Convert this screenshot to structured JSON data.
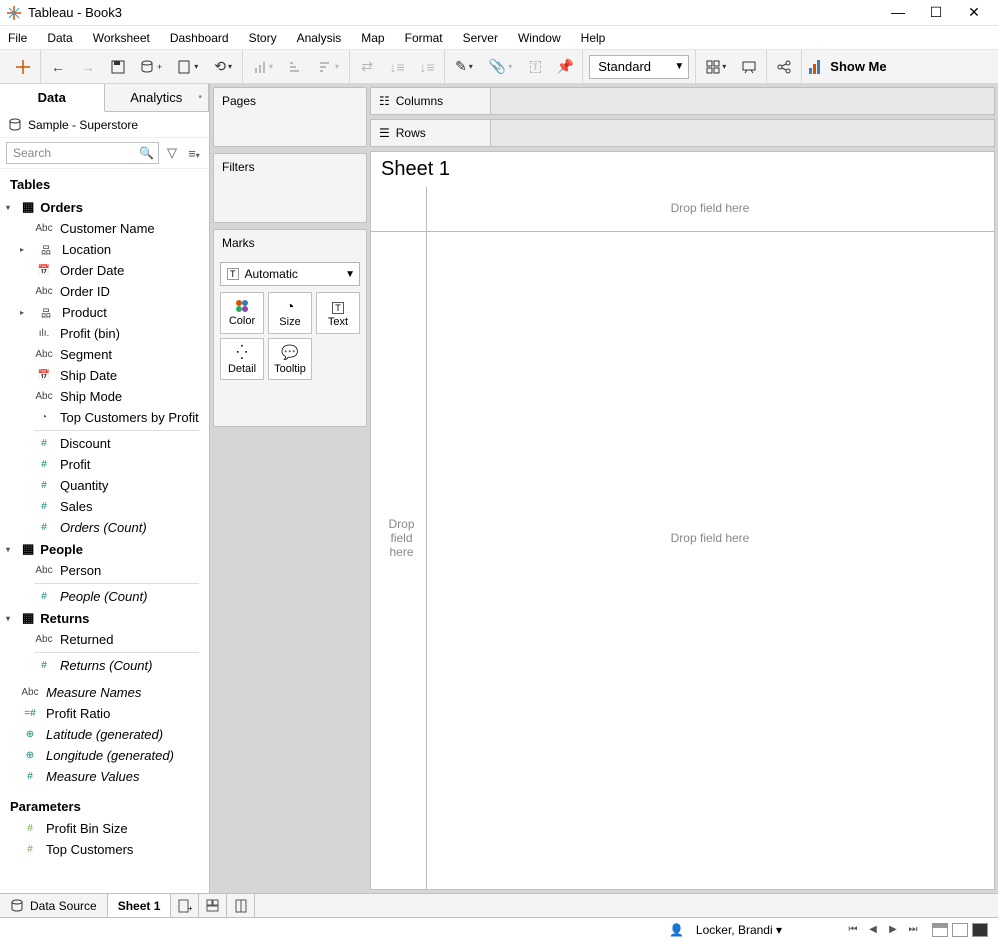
{
  "title": "Tableau - Book3",
  "menu": [
    "File",
    "Data",
    "Worksheet",
    "Dashboard",
    "Story",
    "Analysis",
    "Map",
    "Format",
    "Server",
    "Window",
    "Help"
  ],
  "toolbar": {
    "fit": "Standard",
    "showme": "Show Me"
  },
  "dataTabs": {
    "data": "Data",
    "analytics": "Analytics"
  },
  "dataSource": "Sample - Superstore",
  "search": {
    "placeholder": "Search"
  },
  "tables_h": "Tables",
  "tree": {
    "orders": {
      "name": "Orders",
      "fields": [
        {
          "icon": "Abc",
          "label": "Customer Name",
          "cls": "dim"
        },
        {
          "icon": "⇵",
          "label": "Location",
          "cls": "dim",
          "exp": true
        },
        {
          "icon": "📅",
          "label": "Order Date",
          "cls": "dim"
        },
        {
          "icon": "Abc",
          "label": "Order ID",
          "cls": "dim"
        },
        {
          "icon": "⇵",
          "label": "Product",
          "cls": "dim",
          "exp": true
        },
        {
          "icon": "ılı.",
          "label": "Profit (bin)",
          "cls": "dim"
        },
        {
          "icon": "Abc",
          "label": "Segment",
          "cls": "dim"
        },
        {
          "icon": "📅",
          "label": "Ship Date",
          "cls": "dim"
        },
        {
          "icon": "Abc",
          "label": "Ship Mode",
          "cls": "dim"
        },
        {
          "icon": "◔",
          "label": "Top Customers by Profit",
          "cls": "dim"
        }
      ],
      "sep": true,
      "measures": [
        {
          "icon": "#",
          "label": "Discount"
        },
        {
          "icon": "#",
          "label": "Profit"
        },
        {
          "icon": "#",
          "label": "Quantity"
        },
        {
          "icon": "#",
          "label": "Sales"
        },
        {
          "icon": "#",
          "label": "Orders (Count)",
          "italic": true
        }
      ]
    },
    "people": {
      "name": "People",
      "fields": [
        {
          "icon": "Abc",
          "label": "Person",
          "cls": "dim"
        }
      ],
      "measures": [
        {
          "icon": "#",
          "label": "People (Count)",
          "italic": true
        }
      ]
    },
    "returns": {
      "name": "Returns",
      "fields": [
        {
          "icon": "Abc",
          "label": "Returned",
          "cls": "dim"
        }
      ],
      "measures": [
        {
          "icon": "#",
          "label": "Returns (Count)",
          "italic": true
        }
      ]
    },
    "loose": [
      {
        "icon": "Abc",
        "label": "Measure Names",
        "italic": true,
        "cls": "dim"
      },
      {
        "icon": "=#",
        "label": "Profit Ratio"
      },
      {
        "icon": "⊕",
        "label": "Latitude (generated)",
        "italic": true
      },
      {
        "icon": "⊕",
        "label": "Longitude (generated)",
        "italic": true
      },
      {
        "icon": "#",
        "label": "Measure Values",
        "italic": true
      }
    ]
  },
  "parameters": {
    "h": "Parameters",
    "items": [
      {
        "icon": "#",
        "label": "Profit Bin Size"
      },
      {
        "icon": "#",
        "label": "Top Customers"
      }
    ]
  },
  "shelves": {
    "pages": "Pages",
    "filters": "Filters",
    "marks": "Marks",
    "automatic": "Automatic",
    "buttons": [
      "Color",
      "Size",
      "Text",
      "Detail",
      "Tooltip"
    ]
  },
  "rowscols": {
    "columns": "Columns",
    "rows": "Rows"
  },
  "sheet": {
    "title": "Sheet 1",
    "drop": "Drop field here",
    "drop_left": "Drop\nfield\nhere"
  },
  "bottom": {
    "datasource": "Data Source",
    "sheet1": "Sheet 1"
  },
  "status": {
    "user": "Locker, Brandi"
  }
}
